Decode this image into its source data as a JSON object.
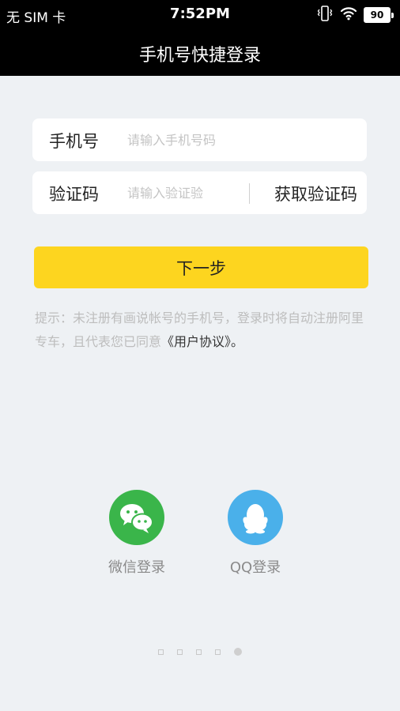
{
  "status_bar": {
    "carrier": "无 SIM 卡",
    "time": "7:52PM",
    "battery": "90"
  },
  "nav": {
    "title": "手机号快捷登录"
  },
  "form": {
    "phone_label": "手机号",
    "phone_placeholder": "请输入手机号码",
    "code_label": "验证码",
    "code_placeholder": "请输入验证验",
    "get_code": "获取验证码",
    "next_button": "下一步"
  },
  "hint": {
    "text": "提示：未注册有画说帐号的手机号，登录时将自动注册阿里专车，且代表您已同意",
    "link": "《用户协议》",
    "suffix": "。"
  },
  "social": {
    "wechat_label": "微信登录",
    "qq_label": "QQ登录"
  },
  "pager": {
    "count": 5,
    "active_index": 4
  },
  "colors": {
    "accent": "#fdd51f",
    "wechat": "#3ab54a",
    "qq": "#4ab0ea",
    "background": "#eef1f4"
  }
}
